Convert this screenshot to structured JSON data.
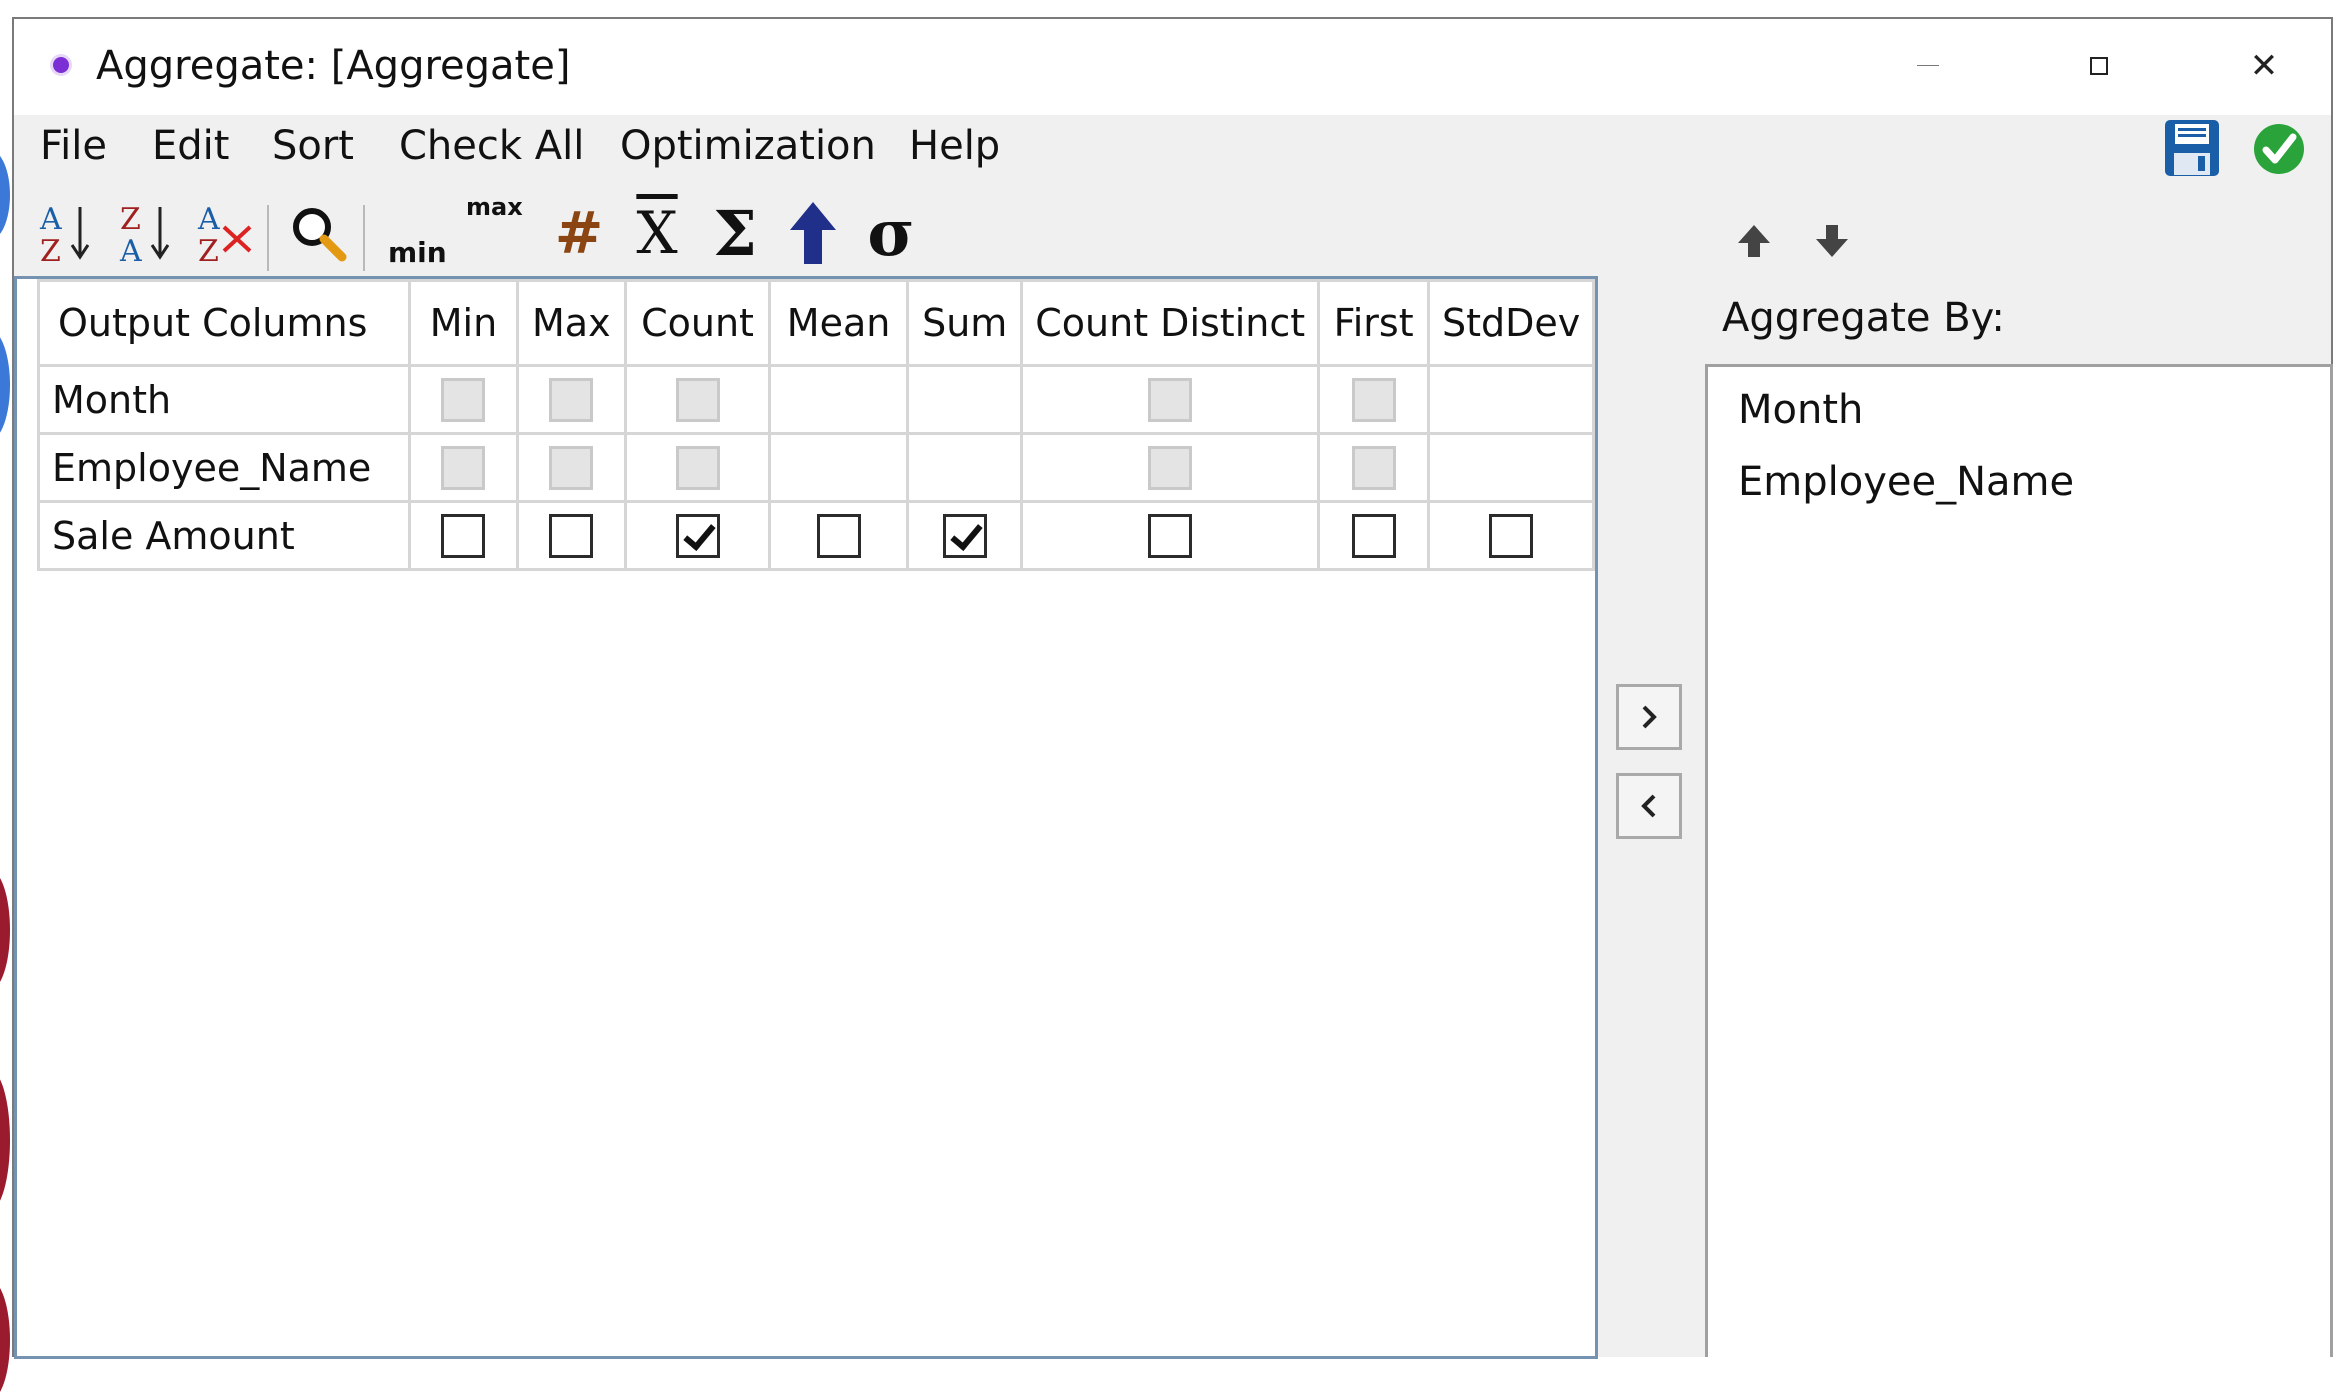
{
  "window": {
    "title": "Aggregate: [Aggregate]",
    "close_glyph": "✕"
  },
  "menu": {
    "items": [
      "File",
      "Edit",
      "Sort",
      "Check All",
      "Optimization",
      "Help"
    ]
  },
  "toolbar": {
    "sort_az_top": "A",
    "sort_az_bottom": "Z",
    "sort_za_top": "Z",
    "sort_za_bottom": "A",
    "clear_sort_top": "A",
    "clear_sort_bottom": "Z",
    "min_label": "min",
    "max_label": "max",
    "count_glyph": "#",
    "mean_glyph": "X",
    "sum_glyph": "Σ",
    "stddev_glyph": "σ"
  },
  "icons": {
    "sort_az": "sort-az-icon",
    "sort_za": "sort-za-icon",
    "clear_sort": "clear-sort-icon",
    "search": "search-icon",
    "minmax": "min-max-icon",
    "count": "hash-icon",
    "mean": "x-bar-icon",
    "sum": "sigma-icon",
    "first": "up-arrow-icon",
    "stddev": "sigma-lower-icon",
    "save": "floppy-disk-icon",
    "ok": "green-check-icon",
    "move_up": "arrow-up-icon",
    "move_down": "arrow-down-icon",
    "add": "chevron-right-icon",
    "remove": "chevron-left-icon"
  },
  "grid": {
    "headers": [
      "Output Columns",
      "Min",
      "Max",
      "Count",
      "Mean",
      "Sum",
      "Count Distinct",
      "First",
      "StdDev"
    ],
    "rows": [
      {
        "name": "Month",
        "cells": [
          "disabled",
          "disabled",
          "disabled",
          "none",
          "none",
          "disabled",
          "disabled",
          "none"
        ]
      },
      {
        "name": "Employee_Name",
        "cells": [
          "disabled",
          "disabled",
          "disabled",
          "none",
          "none",
          "disabled",
          "disabled",
          "none"
        ]
      },
      {
        "name": "Sale Amount",
        "cells": [
          "unchecked",
          "unchecked",
          "checked",
          "unchecked",
          "checked",
          "unchecked",
          "unchecked",
          "unchecked"
        ]
      }
    ]
  },
  "aggregate_by": {
    "label": "Aggregate By:",
    "items": [
      "Month",
      "Employee_Name"
    ]
  },
  "colors": {
    "accent_blue": "#1b5ea8",
    "ok_green": "#2aa43a",
    "first_arrow": "#1f2f8a",
    "count_hash": "#8b4513",
    "panel_border": "#7592b0"
  }
}
